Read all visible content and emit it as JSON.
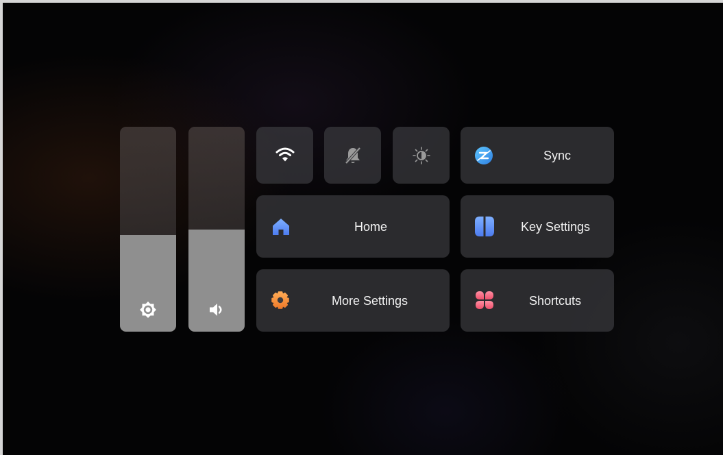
{
  "sliders": {
    "brightness": {
      "icon": "brightness-icon",
      "level": 0.47
    },
    "volume": {
      "icon": "volume-icon",
      "level": 0.5
    }
  },
  "toggles": [
    {
      "icon": "wifi-icon",
      "state": "on"
    },
    {
      "icon": "mute-bell-icon",
      "state": "off"
    },
    {
      "icon": "auto-brightness-icon",
      "state": "off"
    }
  ],
  "tiles": {
    "sync": {
      "label": "Sync",
      "icon": "sync-icon"
    },
    "home": {
      "label": "Home",
      "icon": "home-icon"
    },
    "key_settings": {
      "label": "Key Settings",
      "icon": "key-settings-icon"
    },
    "more_settings": {
      "label": "More Settings",
      "icon": "gear-icon"
    },
    "shortcuts": {
      "label": "Shortcuts",
      "icon": "shortcuts-icon"
    }
  },
  "colors": {
    "tile_bg": "#3a3a3e",
    "slider_fill": "#8f8f8f",
    "home_blue": "#5b8cf5",
    "settings_orange": "#f08a3c",
    "shortcuts_pink": "#f05a78",
    "sync_blue": "#3aa8f0"
  }
}
